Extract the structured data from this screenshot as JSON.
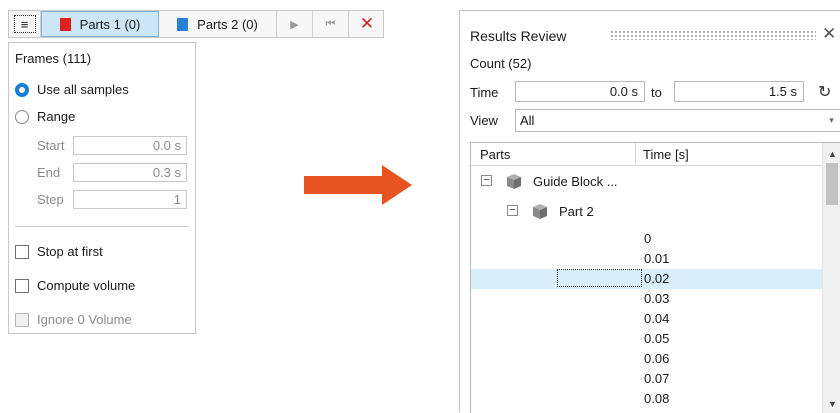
{
  "toolbar": {
    "menu_glyph": "≡",
    "tab1_label": "Parts 1 (0)",
    "tab1_color": "#e01f1f",
    "tab2_label": "Parts 2 (0)",
    "tab2_color": "#2a7fd6",
    "play_glyph": "▶",
    "first_glyph": "⏮",
    "close_glyph": "✕"
  },
  "frames": {
    "title": "Frames (111)",
    "option_all": "Use all samples",
    "option_range": "Range",
    "selected_option": "Use all samples",
    "start_label": "Start",
    "start_value": "0.0 s",
    "end_label": "End",
    "end_value": "0.3 s",
    "step_label": "Step",
    "step_value": "1",
    "stop_at_first": "Stop at first",
    "compute_volume": "Compute volume",
    "ignore_zero_volume": "Ignore 0 Volume"
  },
  "arrow_color": "#e85324",
  "results": {
    "title": "Results Review",
    "close_glyph": "✕",
    "count": "Count (52)",
    "time_label": "Time",
    "time_from": "0.0 s",
    "to_label": "to",
    "time_to": "1.5 s",
    "refresh_glyph": "↻",
    "view_label": "View",
    "view_value": "All",
    "col_parts": "Parts",
    "col_time": "Time [s]",
    "tree": {
      "root_label": "Guide Block ...",
      "child_label": "Part 2",
      "expander_glyph": "−"
    },
    "times": [
      "0",
      "0.01",
      "0.02",
      "0.03",
      "0.04",
      "0.05",
      "0.06",
      "0.07",
      "0.08"
    ],
    "selected_time": "0.02",
    "selection_color": "#d9eefb"
  }
}
